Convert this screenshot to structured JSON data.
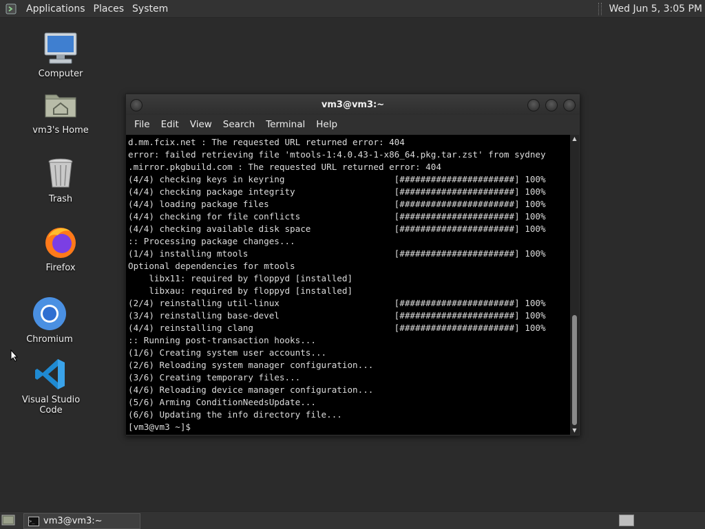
{
  "top_panel": {
    "menus": [
      "Applications",
      "Places",
      "System"
    ],
    "clock": "Wed Jun  5,  3:05 PM"
  },
  "desktop_icons": [
    {
      "label": "Computer",
      "icon": "computer-icon"
    },
    {
      "label": "vm3's Home",
      "icon": "home-folder-icon"
    },
    {
      "label": "Trash",
      "icon": "trash-icon"
    },
    {
      "label": "Firefox",
      "icon": "firefox-icon"
    },
    {
      "label": "Chromium",
      "icon": "chromium-icon"
    },
    {
      "label": "Visual Studio Code",
      "icon": "vscode-icon"
    }
  ],
  "terminal": {
    "title": "vm3@vm3:~",
    "menus": [
      "File",
      "Edit",
      "View",
      "Search",
      "Terminal",
      "Help"
    ],
    "lines": [
      "d.mm.fcix.net : The requested URL returned error: 404",
      "error: failed retrieving file 'mtools-1:4.0.43-1-x86_64.pkg.tar.zst' from sydney",
      ".mirror.pkgbuild.com : The requested URL returned error: 404",
      "(4/4) checking keys in keyring                     [######################] 100%",
      "(4/4) checking package integrity                   [######################] 100%",
      "(4/4) loading package files                        [######################] 100%",
      "(4/4) checking for file conflicts                  [######################] 100%",
      "(4/4) checking available disk space                [######################] 100%",
      ":: Processing package changes...",
      "(1/4) installing mtools                            [######################] 100%",
      "Optional dependencies for mtools",
      "    libx11: required by floppyd [installed]",
      "    libxau: required by floppyd [installed]",
      "(2/4) reinstalling util-linux                      [######################] 100%",
      "(3/4) reinstalling base-devel                      [######################] 100%",
      "(4/4) reinstalling clang                           [######################] 100%",
      ":: Running post-transaction hooks...",
      "(1/6) Creating system user accounts...",
      "(2/6) Reloading system manager configuration...",
      "(3/6) Creating temporary files...",
      "(4/6) Reloading device manager configuration...",
      "(5/6) Arming ConditionNeedsUpdate...",
      "(6/6) Updating the info directory file...",
      "[vm3@vm3 ~]$ "
    ]
  },
  "taskbar": {
    "window_button": "vm3@vm3:~"
  },
  "colors": {
    "desktop_bg": "#2b2b2b",
    "panel_bg": "#333333",
    "terminal_bg": "#000000",
    "terminal_fg": "#dcdcdc"
  }
}
